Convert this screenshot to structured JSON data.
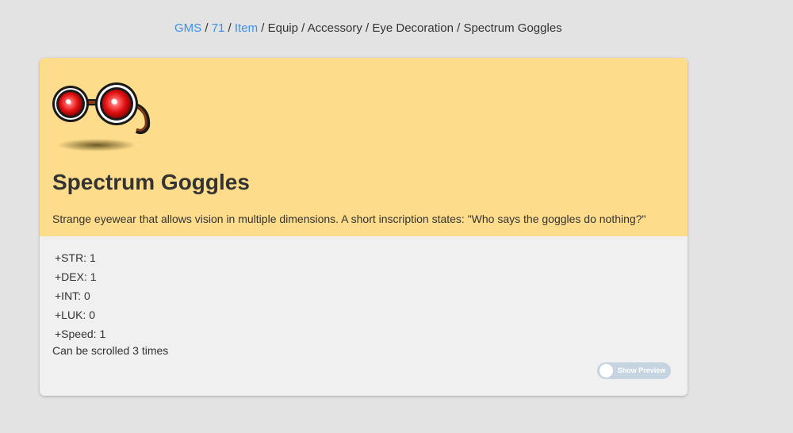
{
  "breadcrumb": {
    "items": [
      {
        "label": "GMS",
        "link": true
      },
      {
        "label": "71",
        "link": true
      },
      {
        "label": "Item",
        "link": true
      },
      {
        "label": "Equip",
        "link": false
      },
      {
        "label": "Accessory",
        "link": false
      },
      {
        "label": "Eye Decoration",
        "link": false
      },
      {
        "label": "Spectrum Goggles",
        "link": false
      }
    ],
    "separator": " / "
  },
  "item": {
    "icon": "goggles-icon",
    "title": "Spectrum Goggles",
    "description": "Strange eyewear that allows vision in multiple dimensions. A short inscription states: \"Who says the goggles do nothing?\"",
    "stats": [
      "+STR: 1",
      "+DEX: 1",
      "+INT: 0",
      "+LUK: 0",
      "+Speed: 1"
    ],
    "scroll_note": "Can be scrolled 3 times"
  },
  "preview_toggle": {
    "label": "Show Preview",
    "state": "off"
  },
  "colors": {
    "background": "#e3e3e3",
    "header": "#fddc8b",
    "card": "#f0f0f0",
    "link": "#3d8fe8",
    "toggle": "#c6d4e2"
  }
}
